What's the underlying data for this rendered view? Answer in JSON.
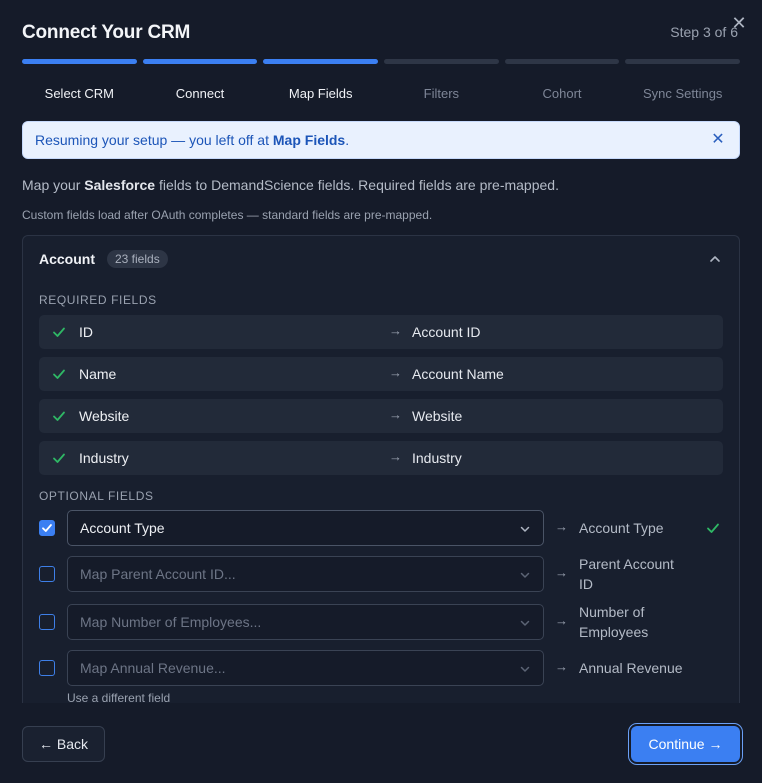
{
  "header": {
    "title": "Connect Your CRM",
    "step_count": "Step 3 of 6",
    "close_symbol": "✕"
  },
  "progress": {
    "completed_steps": 3,
    "total_steps": 6,
    "steps": [
      {
        "label": "Select CRM",
        "state": "done"
      },
      {
        "label": "Connect",
        "state": "done"
      },
      {
        "label": "Map Fields",
        "state": "current"
      },
      {
        "label": "Filters",
        "state": "future"
      },
      {
        "label": "Cohort",
        "state": "future"
      },
      {
        "label": "Sync Settings",
        "state": "future"
      }
    ]
  },
  "banner": {
    "prefix": "Resuming your setup — you left off at ",
    "highlight": "Map Fields",
    "suffix": ".",
    "close_symbol": "✕"
  },
  "description": {
    "prefix": "Map your ",
    "crm_name": "Salesforce",
    "suffix": " fields to DemandScience fields. Required fields are pre-mapped."
  },
  "note": "Custom fields load after OAuth completes — standard fields are pre-mapped.",
  "panel": {
    "title": "Account",
    "badge": "23 fields",
    "required_heading": "REQUIRED FIELDS",
    "optional_heading": "OPTIONAL FIELDS",
    "arrow": "→",
    "required": [
      {
        "source": "ID",
        "target": "Account ID"
      },
      {
        "source": "Name",
        "target": "Account Name"
      },
      {
        "source": "Website",
        "target": "Website"
      },
      {
        "source": "Industry",
        "target": "Industry"
      }
    ],
    "optional": [
      {
        "checked": true,
        "value": "Account Type",
        "placeholder": "",
        "target": "Account Type",
        "mapped": true
      },
      {
        "checked": false,
        "value": "",
        "placeholder": "Map Parent Account ID...",
        "target": "Parent Account ID",
        "mapped": false
      },
      {
        "checked": false,
        "value": "",
        "placeholder": "Map Number of Employees...",
        "target": "Number of Employees",
        "mapped": false
      },
      {
        "checked": false,
        "value": "",
        "placeholder": "Map Annual Revenue...",
        "target": "Annual Revenue",
        "mapped": false
      }
    ],
    "hint": "Use a different field"
  },
  "footer": {
    "back_label": "← Back",
    "continue_label": "Continue →"
  },
  "colors": {
    "accent": "#3b7ff2",
    "success": "#2fb865",
    "background": "#151b29"
  }
}
